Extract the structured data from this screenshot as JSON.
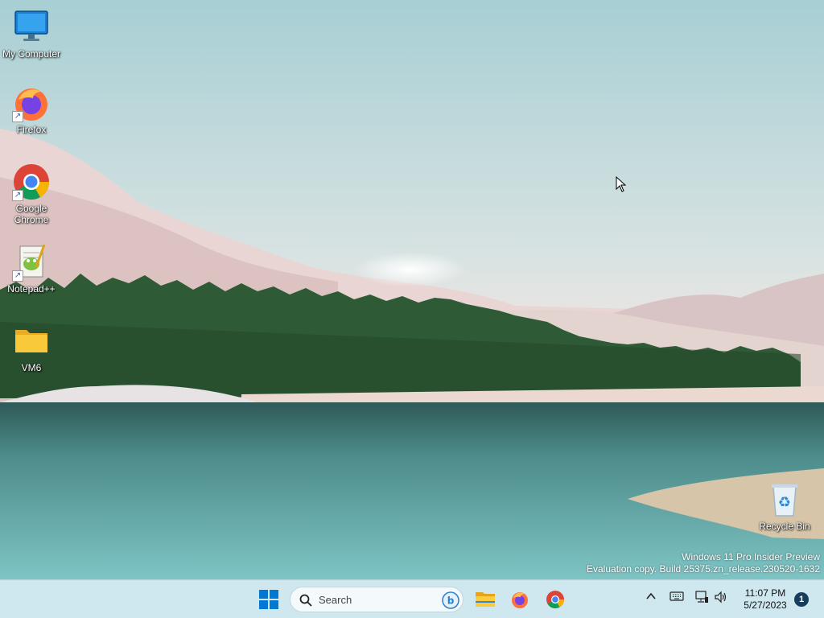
{
  "desktop": {
    "icons": [
      {
        "label": "My Computer",
        "icon": "monitor-icon"
      },
      {
        "label": "Firefox",
        "icon": "firefox-icon"
      },
      {
        "label": "Google\nChrome",
        "icon": "chrome-icon"
      },
      {
        "label": "Notepad++",
        "icon": "notepadpp-icon"
      },
      {
        "label": "VM6",
        "icon": "folder-icon"
      },
      {
        "label": "Recycle Bin",
        "icon": "recycle-bin-icon"
      }
    ],
    "watermark": {
      "line1": "Windows 11 Pro Insider Preview",
      "line2": "Evaluation copy. Build 25375.zn_release.230520-1632"
    }
  },
  "taskbar": {
    "search_placeholder": "Search",
    "pinned": [
      "start-icon",
      "file-explorer-icon",
      "firefox-icon",
      "chrome-icon"
    ],
    "clock": {
      "time": "11:07 PM",
      "date": "5/27/2023"
    },
    "notification_count": "1",
    "tray_icons": [
      "chevron-up-icon",
      "keyboard-icon",
      "network-icon",
      "volume-icon"
    ]
  },
  "colors": {
    "taskbar_bg": "#cfe7ee",
    "windows_blue": "#0078d4",
    "folder_yellow": "#f8c93b"
  }
}
